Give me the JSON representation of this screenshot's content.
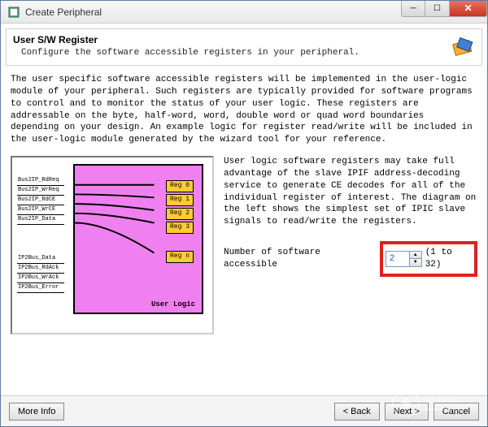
{
  "window": {
    "title": "Create Peripheral"
  },
  "header": {
    "title": "User S/W Register",
    "subtitle": "Configure the software accessible registers in your peripheral."
  },
  "intro": "The user specific software accessible registers will be implemented in the user-logic module of your peripheral. Such registers are typically provided for software programs to control and to monitor the status of your user logic. These registers are addressable on the byte, half-word, word, double word or quad word boundaries depending on your design. An example logic for register read/write will be included in the user-logic module generated by the wizard tool for your reference.",
  "diagram": {
    "signals_top": [
      "Bus2IP_RdReq",
      "Bus2IP_WrReq",
      "Bus2IP_RdCE",
      "Bus2IP_WrCE",
      "Bus2IP_Data"
    ],
    "signals_bottom": [
      "IP2Bus_Data",
      "IP2Bus_RdAck",
      "IP2Bus_WrAck",
      "IP2Bus_Error"
    ],
    "regs": [
      "Reg 0",
      "Reg 1",
      "Reg 2",
      "Reg 3",
      "Reg n"
    ],
    "block_label": "User Logic"
  },
  "right": {
    "paragraph": "User logic software registers may take full advantage of the slave IPIF address-decoding service to generate CE decodes for all of the individual register of interest. The diagram on the left shows the simplest set of IPIC slave signals to read/write the registers.",
    "num_label": "Number of software accessible",
    "num_value": "2",
    "num_range": "(1 to 32)"
  },
  "footer": {
    "more": "More Info",
    "back": "< Back",
    "next": "Next >",
    "cancel": "Cancel"
  }
}
